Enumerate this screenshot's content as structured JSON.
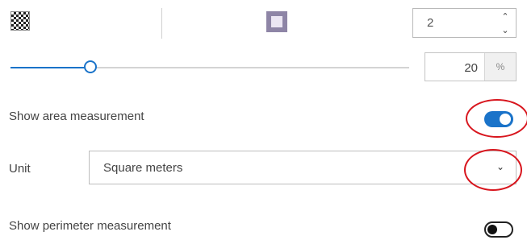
{
  "symbol": {
    "fill_swatch_icon": "checkerboard-pattern-icon",
    "outline_swatch_icon": "square-outline-icon",
    "outline_width": "2",
    "stepper_up_glyph": "⌃",
    "stepper_down_glyph": "⌄"
  },
  "transparency": {
    "value": "20",
    "unit": "%",
    "slider_level_percent": 20
  },
  "area_measurement": {
    "label": "Show area measurement",
    "enabled": true
  },
  "unit": {
    "label": "Unit",
    "selected": "Square meters",
    "chevron_glyph": "⌄"
  },
  "perimeter_measurement": {
    "label": "Show perimeter measurement",
    "enabled": false
  },
  "colors": {
    "accent": "#1a73c9",
    "annotation": "#d8161e"
  }
}
